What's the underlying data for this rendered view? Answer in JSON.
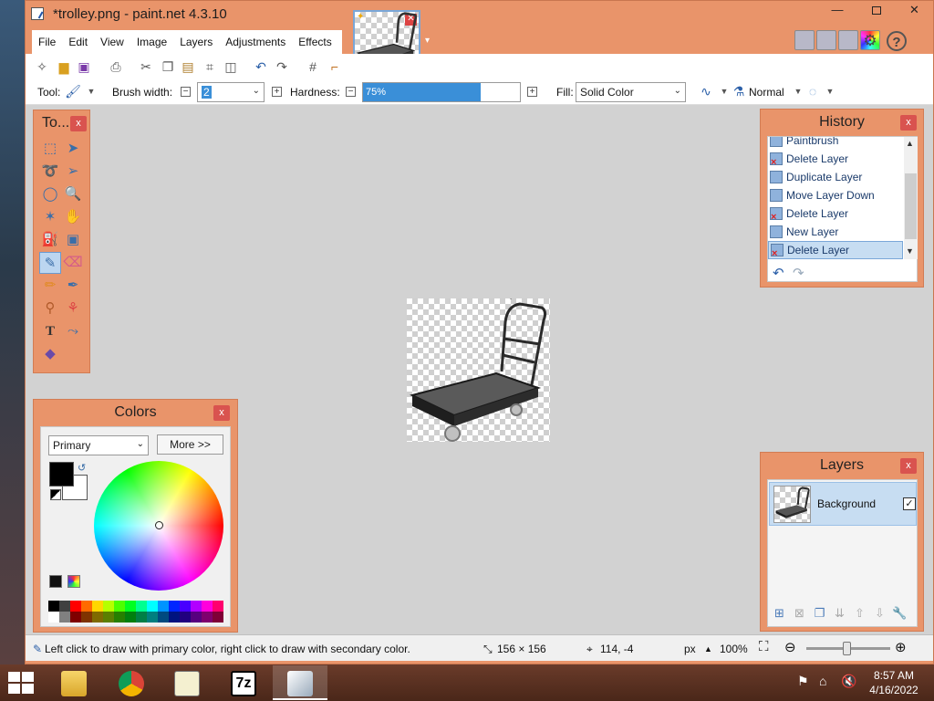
{
  "window": {
    "title": "*trolley.png - paint.net 4.3.10",
    "minimize_label": "—",
    "close_label": "✕"
  },
  "menu": [
    "File",
    "Edit",
    "View",
    "Image",
    "Layers",
    "Adjustments",
    "Effects"
  ],
  "toolbar": {
    "tool_label": "Tool:",
    "brush_width_label": "Brush width:",
    "brush_width_value": "2",
    "hardness_label": "Hardness:",
    "hardness_value": "75%",
    "hardness_fraction": 0.75,
    "fill_label": "Fill:",
    "fill_value": "Solid Color",
    "blend_mode": "Normal"
  },
  "tools_panel": {
    "title": "To...",
    "close": "x"
  },
  "colors_panel": {
    "title": "Colors",
    "close": "x",
    "mode_value": "Primary",
    "more_label": "More >>",
    "primary_color": "#000000",
    "secondary_color": "#ffffff"
  },
  "history_panel": {
    "title": "History",
    "close": "x",
    "items": [
      {
        "label": "Paintbrush",
        "icon": "paintbrush-icon"
      },
      {
        "label": "Delete Layer",
        "icon": "delete-layer-icon"
      },
      {
        "label": "Duplicate Layer",
        "icon": "duplicate-layer-icon"
      },
      {
        "label": "Move Layer Down",
        "icon": "move-layer-down-icon"
      },
      {
        "label": "Delete Layer",
        "icon": "delete-layer-icon"
      },
      {
        "label": "New Layer",
        "icon": "new-layer-icon"
      },
      {
        "label": "Delete Layer",
        "icon": "delete-layer-icon",
        "selected": true
      }
    ]
  },
  "layers_panel": {
    "title": "Layers",
    "close": "x",
    "layers": [
      {
        "name": "Background",
        "visible": true,
        "selected": true
      }
    ]
  },
  "status": {
    "hint": "Left click to draw with primary color, right click to draw with secondary color.",
    "image_size": "156 × 156",
    "cursor_pos": "114, -4",
    "units": "px",
    "zoom": "100%"
  },
  "taskbar": {
    "time": "8:57 AM",
    "date": "4/16/2022",
    "apps": [
      "file-explorer",
      "chrome",
      "notepad",
      "7zip",
      "paint.net"
    ]
  },
  "palette_colors": [
    "#000000",
    "#404040",
    "#ff0000",
    "#ff6a00",
    "#ffd800",
    "#b6ff00",
    "#4cff00",
    "#00ff21",
    "#00ff90",
    "#00ffff",
    "#0094ff",
    "#0026ff",
    "#4800ff",
    "#b200ff",
    "#ff00dc",
    "#ff006e",
    "#ffffff",
    "#808080",
    "#7f0000",
    "#7f3300",
    "#7f6a00",
    "#5b7f00",
    "#267f00",
    "#007f0e",
    "#007f46",
    "#007f7f",
    "#004a7f",
    "#00137f",
    "#21007f",
    "#57007f",
    "#7f006e",
    "#7f0037"
  ]
}
